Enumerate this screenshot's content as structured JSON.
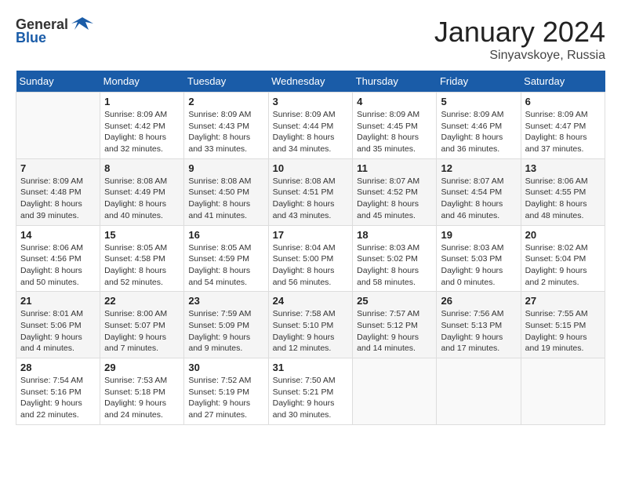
{
  "header": {
    "logo_general": "General",
    "logo_blue": "Blue",
    "title": "January 2024",
    "location": "Sinyavskoye, Russia"
  },
  "weekdays": [
    "Sunday",
    "Monday",
    "Tuesday",
    "Wednesday",
    "Thursday",
    "Friday",
    "Saturday"
  ],
  "weeks": [
    [
      {
        "day": "",
        "info": ""
      },
      {
        "day": "1",
        "info": "Sunrise: 8:09 AM\nSunset: 4:42 PM\nDaylight: 8 hours\nand 32 minutes."
      },
      {
        "day": "2",
        "info": "Sunrise: 8:09 AM\nSunset: 4:43 PM\nDaylight: 8 hours\nand 33 minutes."
      },
      {
        "day": "3",
        "info": "Sunrise: 8:09 AM\nSunset: 4:44 PM\nDaylight: 8 hours\nand 34 minutes."
      },
      {
        "day": "4",
        "info": "Sunrise: 8:09 AM\nSunset: 4:45 PM\nDaylight: 8 hours\nand 35 minutes."
      },
      {
        "day": "5",
        "info": "Sunrise: 8:09 AM\nSunset: 4:46 PM\nDaylight: 8 hours\nand 36 minutes."
      },
      {
        "day": "6",
        "info": "Sunrise: 8:09 AM\nSunset: 4:47 PM\nDaylight: 8 hours\nand 37 minutes."
      }
    ],
    [
      {
        "day": "7",
        "info": "Sunrise: 8:09 AM\nSunset: 4:48 PM\nDaylight: 8 hours\nand 39 minutes."
      },
      {
        "day": "8",
        "info": "Sunrise: 8:08 AM\nSunset: 4:49 PM\nDaylight: 8 hours\nand 40 minutes."
      },
      {
        "day": "9",
        "info": "Sunrise: 8:08 AM\nSunset: 4:50 PM\nDaylight: 8 hours\nand 41 minutes."
      },
      {
        "day": "10",
        "info": "Sunrise: 8:08 AM\nSunset: 4:51 PM\nDaylight: 8 hours\nand 43 minutes."
      },
      {
        "day": "11",
        "info": "Sunrise: 8:07 AM\nSunset: 4:52 PM\nDaylight: 8 hours\nand 45 minutes."
      },
      {
        "day": "12",
        "info": "Sunrise: 8:07 AM\nSunset: 4:54 PM\nDaylight: 8 hours\nand 46 minutes."
      },
      {
        "day": "13",
        "info": "Sunrise: 8:06 AM\nSunset: 4:55 PM\nDaylight: 8 hours\nand 48 minutes."
      }
    ],
    [
      {
        "day": "14",
        "info": "Sunrise: 8:06 AM\nSunset: 4:56 PM\nDaylight: 8 hours\nand 50 minutes."
      },
      {
        "day": "15",
        "info": "Sunrise: 8:05 AM\nSunset: 4:58 PM\nDaylight: 8 hours\nand 52 minutes."
      },
      {
        "day": "16",
        "info": "Sunrise: 8:05 AM\nSunset: 4:59 PM\nDaylight: 8 hours\nand 54 minutes."
      },
      {
        "day": "17",
        "info": "Sunrise: 8:04 AM\nSunset: 5:00 PM\nDaylight: 8 hours\nand 56 minutes."
      },
      {
        "day": "18",
        "info": "Sunrise: 8:03 AM\nSunset: 5:02 PM\nDaylight: 8 hours\nand 58 minutes."
      },
      {
        "day": "19",
        "info": "Sunrise: 8:03 AM\nSunset: 5:03 PM\nDaylight: 9 hours\nand 0 minutes."
      },
      {
        "day": "20",
        "info": "Sunrise: 8:02 AM\nSunset: 5:04 PM\nDaylight: 9 hours\nand 2 minutes."
      }
    ],
    [
      {
        "day": "21",
        "info": "Sunrise: 8:01 AM\nSunset: 5:06 PM\nDaylight: 9 hours\nand 4 minutes."
      },
      {
        "day": "22",
        "info": "Sunrise: 8:00 AM\nSunset: 5:07 PM\nDaylight: 9 hours\nand 7 minutes."
      },
      {
        "day": "23",
        "info": "Sunrise: 7:59 AM\nSunset: 5:09 PM\nDaylight: 9 hours\nand 9 minutes."
      },
      {
        "day": "24",
        "info": "Sunrise: 7:58 AM\nSunset: 5:10 PM\nDaylight: 9 hours\nand 12 minutes."
      },
      {
        "day": "25",
        "info": "Sunrise: 7:57 AM\nSunset: 5:12 PM\nDaylight: 9 hours\nand 14 minutes."
      },
      {
        "day": "26",
        "info": "Sunrise: 7:56 AM\nSunset: 5:13 PM\nDaylight: 9 hours\nand 17 minutes."
      },
      {
        "day": "27",
        "info": "Sunrise: 7:55 AM\nSunset: 5:15 PM\nDaylight: 9 hours\nand 19 minutes."
      }
    ],
    [
      {
        "day": "28",
        "info": "Sunrise: 7:54 AM\nSunset: 5:16 PM\nDaylight: 9 hours\nand 22 minutes."
      },
      {
        "day": "29",
        "info": "Sunrise: 7:53 AM\nSunset: 5:18 PM\nDaylight: 9 hours\nand 24 minutes."
      },
      {
        "day": "30",
        "info": "Sunrise: 7:52 AM\nSunset: 5:19 PM\nDaylight: 9 hours\nand 27 minutes."
      },
      {
        "day": "31",
        "info": "Sunrise: 7:50 AM\nSunset: 5:21 PM\nDaylight: 9 hours\nand 30 minutes."
      },
      {
        "day": "",
        "info": ""
      },
      {
        "day": "",
        "info": ""
      },
      {
        "day": "",
        "info": ""
      }
    ]
  ]
}
